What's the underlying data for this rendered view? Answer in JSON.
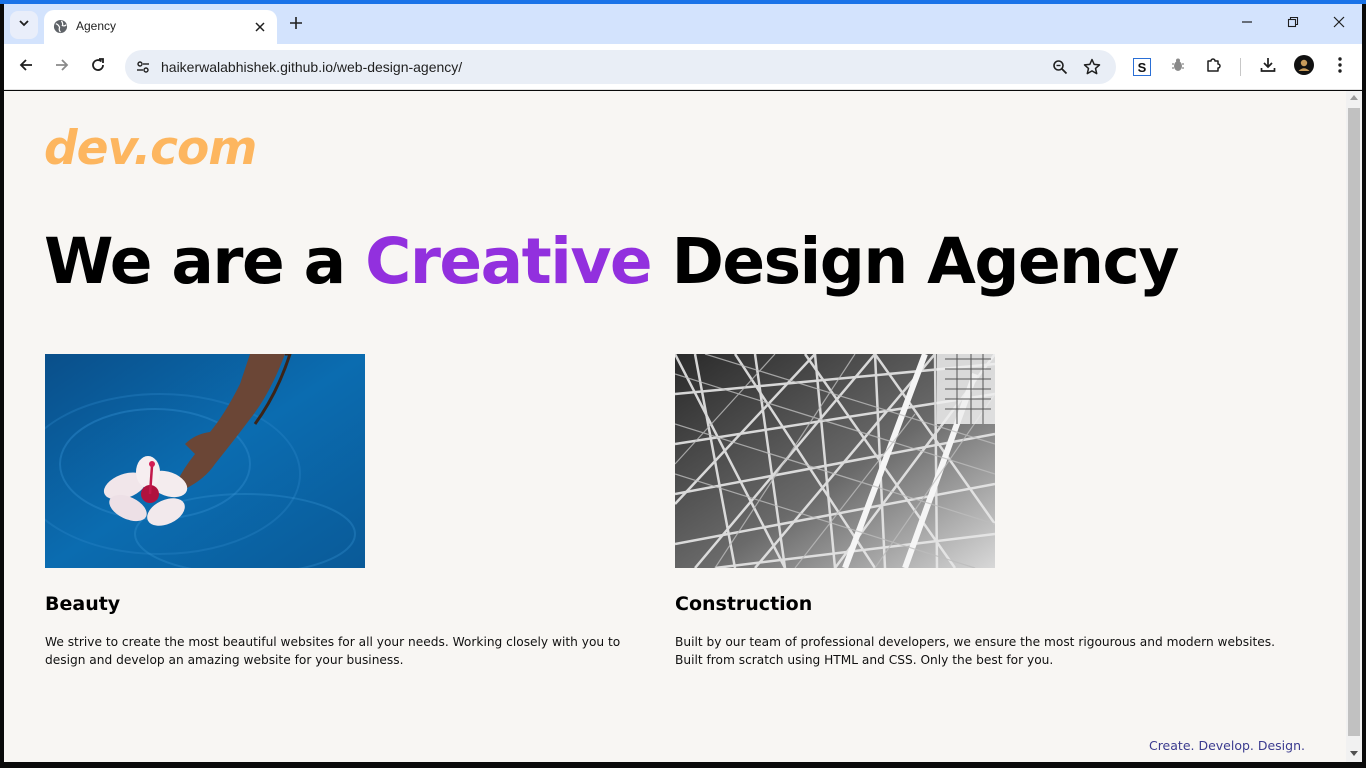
{
  "browser": {
    "tab_title": "Agency",
    "url": "haikerwalabhishek.github.io/web-design-agency/",
    "extension_s_label": "S"
  },
  "site": {
    "logo": "dev.com",
    "headline_pre": "We are a ",
    "headline_accent": "Creative",
    "headline_post": " Design Agency",
    "cards": [
      {
        "title": "Beauty",
        "text": "We strive to create the most beautiful websites for all your needs. Working closely with you to design and develop an amazing website for your business."
      },
      {
        "title": "Construction",
        "text": "Built by our team of professional developers, we ensure the most rigourous and modern websites. Built from scratch using HTML and CSS. Only the best for you."
      }
    ],
    "tagline": "Create. Develop. Design."
  },
  "colors": {
    "logo": "#fdb65f",
    "accent": "#9230de",
    "tagline": "#3b3b8f",
    "page_background": "#f8f6f3",
    "browser_accent": "#1a73e8"
  }
}
